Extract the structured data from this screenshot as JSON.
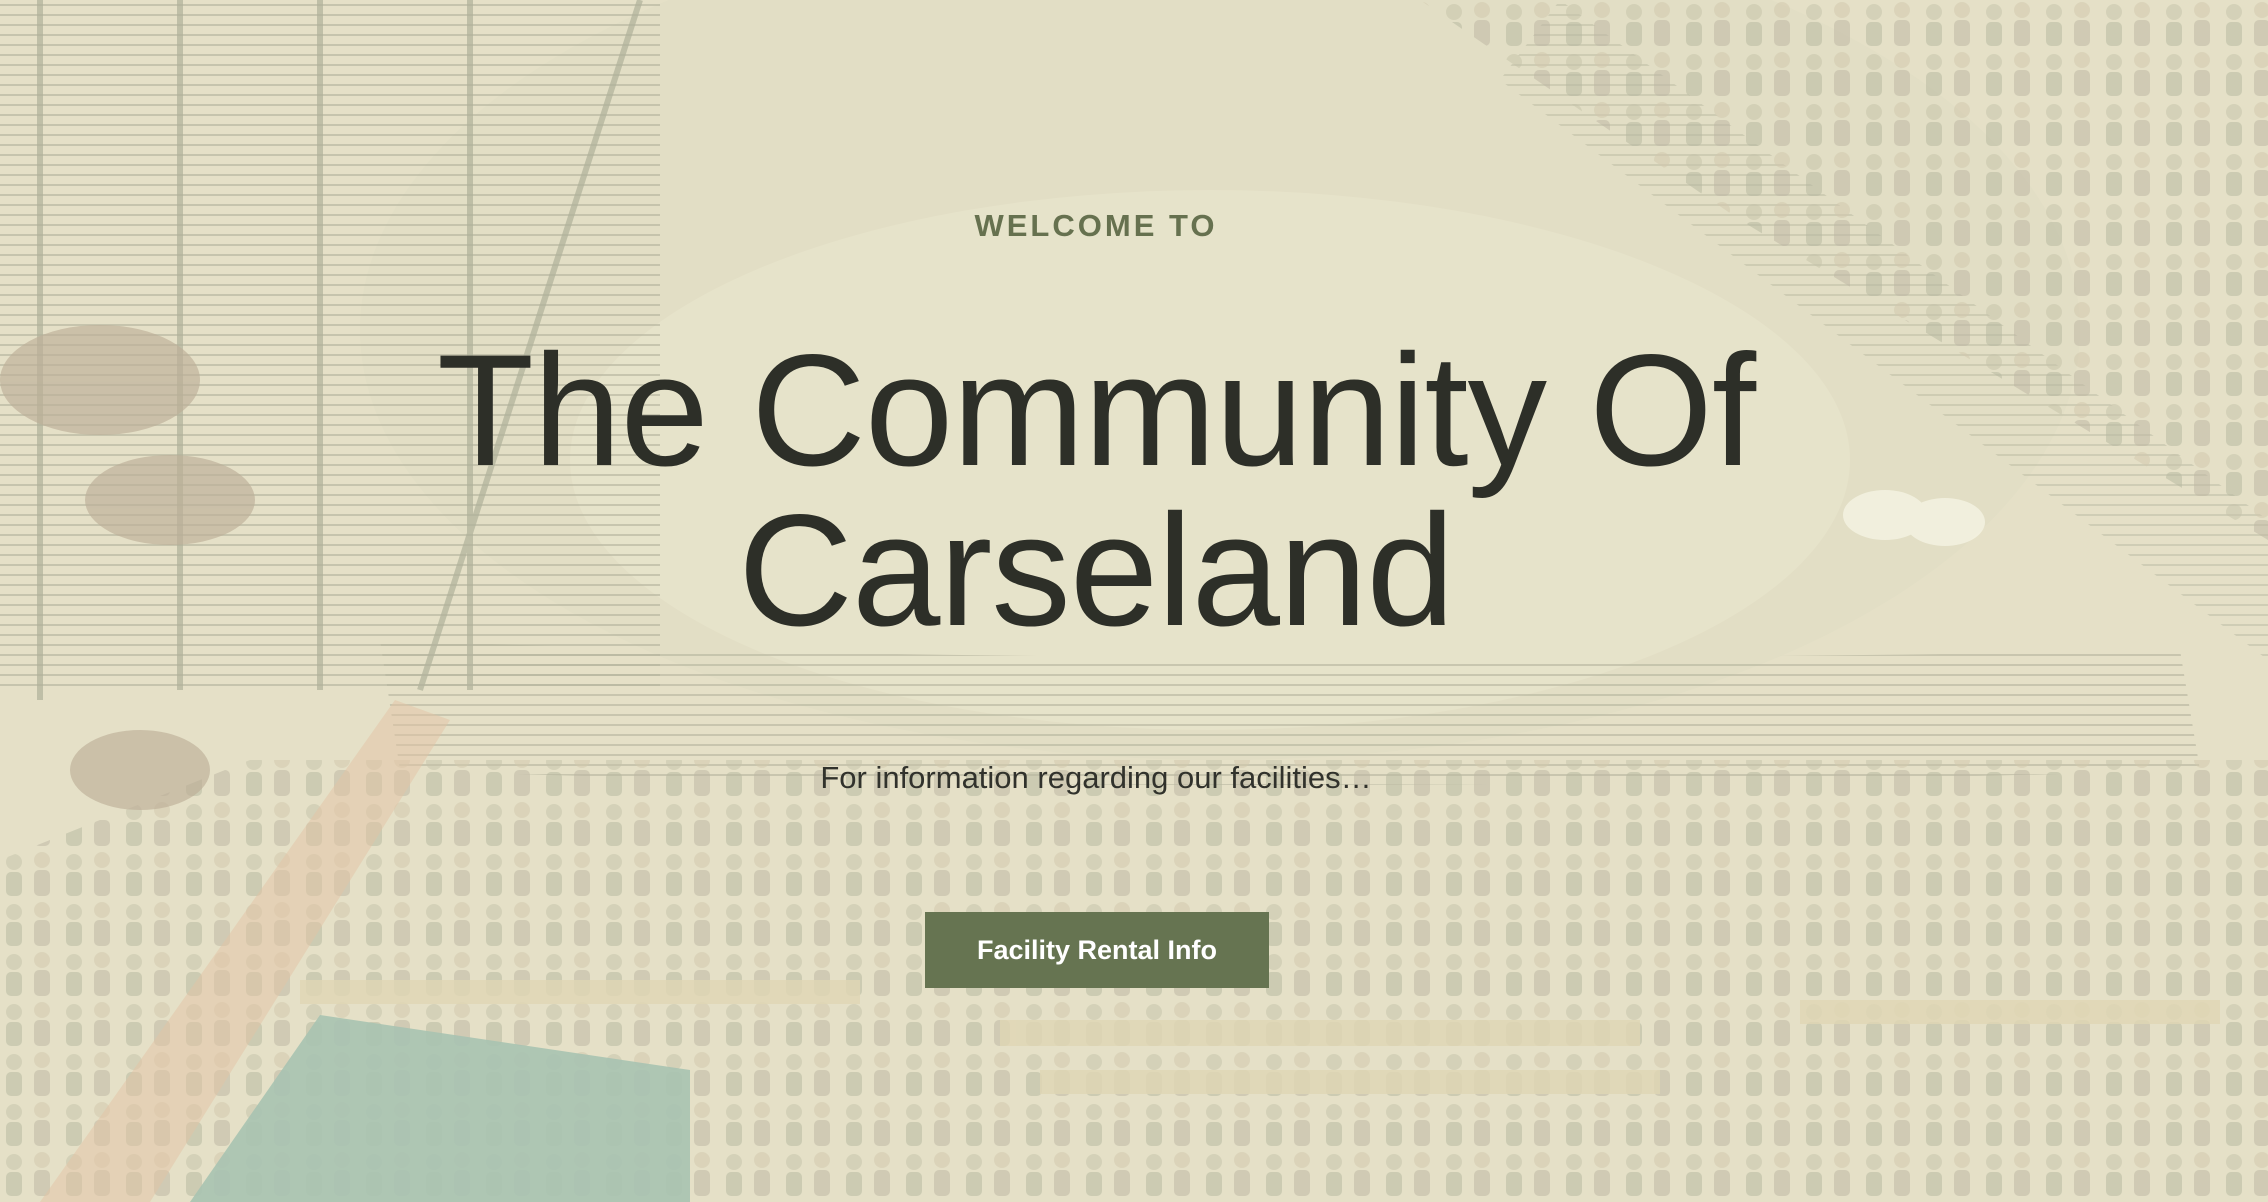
{
  "hero": {
    "eyebrow": "WELCOME TO",
    "title": "The Community Of Carseland",
    "subtitle": "For information regarding our facilities…",
    "cta_label": "Facility Rental Info",
    "background_image": "aerial view of rodeo arena with livestock pens and spectators"
  },
  "colors": {
    "background": "#eeedd2",
    "accent": "#667451",
    "eyebrow": "#66714f",
    "title": "#2d2f28",
    "text": "#31322c"
  }
}
